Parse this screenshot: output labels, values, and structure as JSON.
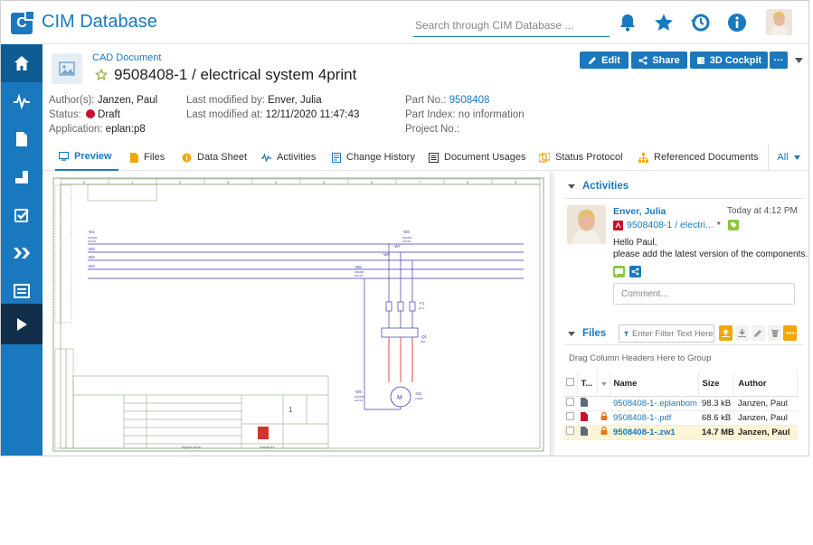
{
  "app": {
    "title": "CIM Database",
    "logo_letter": "C"
  },
  "search": {
    "placeholder": "Search through CIM Database ..."
  },
  "header_icons": [
    "bell-icon",
    "star-icon",
    "history-icon",
    "info-icon"
  ],
  "sidebar": {
    "items": [
      {
        "name": "home-icon",
        "active": true
      },
      {
        "name": "activity-icon"
      },
      {
        "name": "document-icon"
      },
      {
        "name": "part-icon"
      },
      {
        "name": "tasks-icon"
      },
      {
        "name": "workflow-icon"
      },
      {
        "name": "board-icon"
      },
      {
        "name": "play-icon",
        "dark": true
      }
    ]
  },
  "document": {
    "type": "CAD Document",
    "title": "9508408-1 / electrical system 4print",
    "actions": {
      "edit": "Edit",
      "share": "Share",
      "cockpit": "3D Cockpit",
      "more": "···"
    },
    "meta": {
      "authors_label": "Author(s):",
      "authors": "Janzen, Paul",
      "status_label": "Status:",
      "status": "Draft",
      "application_label": "Application:",
      "application": "eplan:p8",
      "modified_by_label": "Last modified by:",
      "modified_by": "Enver, Julia",
      "modified_at_label": "Last modified at:",
      "modified_at": "12/11/2020 11:47:43",
      "part_no_label": "Part No.:",
      "part_no": "9508408",
      "part_index": "Part Index: no information",
      "project_no": "Project No.:"
    }
  },
  "tabs": [
    {
      "label": "Preview",
      "icon": "monitor-icon",
      "active": true
    },
    {
      "label": "Files",
      "icon": "file-icon"
    },
    {
      "label": "Data Sheet",
      "icon": "info-circle-icon"
    },
    {
      "label": "Activities",
      "icon": "activity-icon"
    },
    {
      "label": "Change History",
      "icon": "history-doc-icon"
    },
    {
      "label": "Document Usages",
      "icon": "usages-icon"
    },
    {
      "label": "Status Protocol",
      "icon": "protocol-icon"
    },
    {
      "label": "Referenced Documents",
      "icon": "hierarchy-icon"
    }
  ],
  "tab_all": "All",
  "preview": {
    "column_numbers": [
      "0",
      "1",
      "2",
      "3",
      "4",
      "5",
      "6",
      "7",
      "8",
      "9"
    ],
    "labels": {
      "w1": "-W1",
      "w1_spec": "2X0200",
      "w1_sub": "2x0.64",
      "w2": "-W2",
      "w3": "-W3",
      "w4": "-W4",
      "w8": "-W8",
      "w8_spec": "2X0200",
      "w8_sub": "2x0.64",
      "w7": "-W7",
      "w5": "-W5",
      "w6": "-W6",
      "w5_spec": "2X0200",
      "w5_sub": "2x0.64",
      "f1": "-F1",
      "f1_sub": "25 A",
      "q1": "-Q1",
      "q1_sub": "63A",
      "m1": "-M1",
      "m1_sub": "0.2kW",
      "motor_text": "M",
      "w9": "-W9",
      "w9_spec": "2X0200",
      "w9_sub": "2x0.64",
      "sheet_no": "1",
      "kopiert": "Kopiert durch",
      "format": "Format A3"
    }
  },
  "activities": {
    "title": "Activities",
    "author": "Enver, Julia",
    "time": "Today at 4:12 PM",
    "doc": "9508408-1 / electri...",
    "doc_suffix": "*",
    "greeting": "Hello Paul,",
    "message": "please add the latest version of the components.",
    "comment_placeholder": "Comment..."
  },
  "files": {
    "title": "Files",
    "filter_placeholder": "Enter Filter Text Here",
    "drag_hint": "Drag Column Headers Here to Group",
    "columns": {
      "type": "T...",
      "name": "Name",
      "size": "Size",
      "author": "Author"
    },
    "rows": [
      {
        "name": "9508408-1-.eplanbom",
        "size": "98.3 kB",
        "author": "Janzen, Paul",
        "locked": false,
        "selected": false
      },
      {
        "name": "9508408-1-.pdf",
        "size": "68.6 kB",
        "author": "Janzen, Paul",
        "locked": true,
        "selected": false
      },
      {
        "name": "9508408-1-.zw1",
        "size": "14.7 MB",
        "author": "Janzen, Paul",
        "locked": true,
        "selected": true
      }
    ]
  },
  "colors": {
    "brand": "#1a78be",
    "sidebar_dark": "#112f48",
    "draft": "#c8102e",
    "lock": "#e8731b",
    "tag": "#8dc63f"
  }
}
